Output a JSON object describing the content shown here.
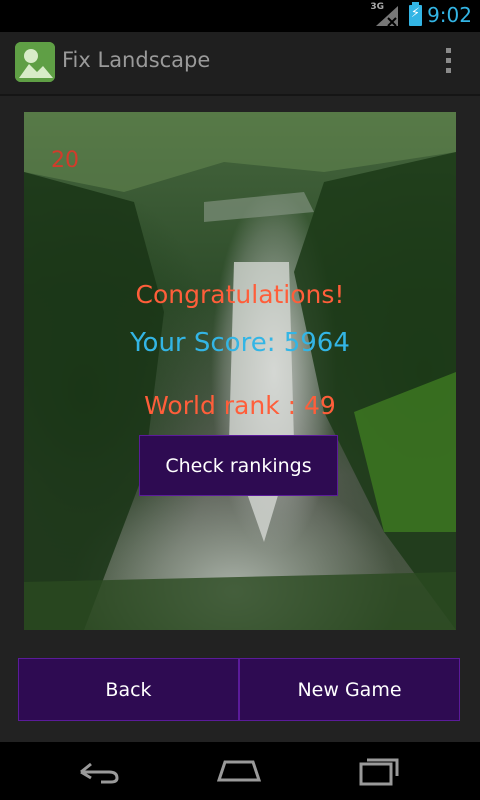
{
  "status_bar": {
    "network": "3G",
    "time": "9:02"
  },
  "action_bar": {
    "title": "Fix Landscape",
    "app_icon": "landscape-app-icon",
    "overflow_icon": "overflow-menu-icon"
  },
  "game": {
    "counter": "20",
    "congrats": "Congratulations!",
    "score_text": "Your Score: 5964",
    "rank_text": "World rank : 49",
    "check_rankings_label": "Check rankings"
  },
  "bottom_buttons": {
    "back_label": "Back",
    "new_game_label": "New Game"
  },
  "nav": {
    "back_icon": "nav-back-icon",
    "home_icon": "nav-home-icon",
    "recents_icon": "nav-recents-icon"
  },
  "colors": {
    "accent": "#33b5e5",
    "highlight": "#ff5e3a",
    "button_bg": "#2e0b52",
    "button_border": "#5b1b9a"
  }
}
